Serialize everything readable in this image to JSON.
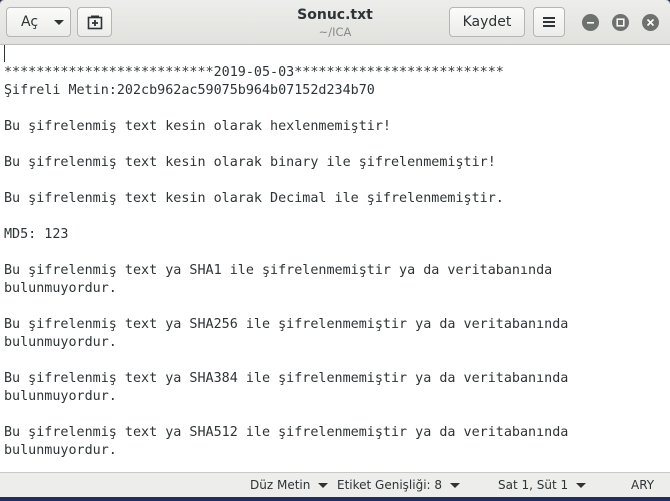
{
  "header": {
    "open_label": "Aç",
    "title": "Sonuc.txt",
    "subtitle": "~/ICA",
    "save_label": "Kaydet"
  },
  "editor": {
    "lines": [
      "",
      "**************************2019-05-03**************************",
      "Şifreli Metin:202cb962ac59075b964b07152d234b70",
      "",
      "Bu şifrelenmiş text kesin olarak hexlenmemiştir!",
      "",
      "Bu şifrelenmiş text kesin olarak binary ile şifrelenmemiştir!",
      "",
      "Bu şifrelenmiş text kesin olarak Decimal ile şifrelenmemiştir.",
      "",
      "MD5: 123",
      "",
      "Bu şifrelenmiş text ya SHA1 ile şifrelenmemiştir ya da veritabanında",
      "bulunmuyordur.",
      "",
      "Bu şifrelenmiş text ya SHA256 ile şifrelenmemiştir ya da veritabanında",
      "bulunmuyordur.",
      "",
      "Bu şifrelenmiş text ya SHA384 ile şifrelenmemiştir ya da veritabanında",
      "bulunmuyordur.",
      "",
      "Bu şifrelenmiş text ya SHA512 ile şifrelenmemiştir ya da veritabanında",
      "bulunmuyordur."
    ]
  },
  "statusbar": {
    "language": "Düz Metin",
    "tab_width": "Etiket Genişliği: 8",
    "position": "Sat 1, Süt 1",
    "mode": "ARY"
  },
  "icons": {
    "open": "chevron-down-icon",
    "new_tab": "new-tab-icon",
    "menu": "hamburger-menu-icon",
    "minimize": "minimize-icon",
    "maximize": "maximize-icon",
    "close": "close-icon"
  }
}
